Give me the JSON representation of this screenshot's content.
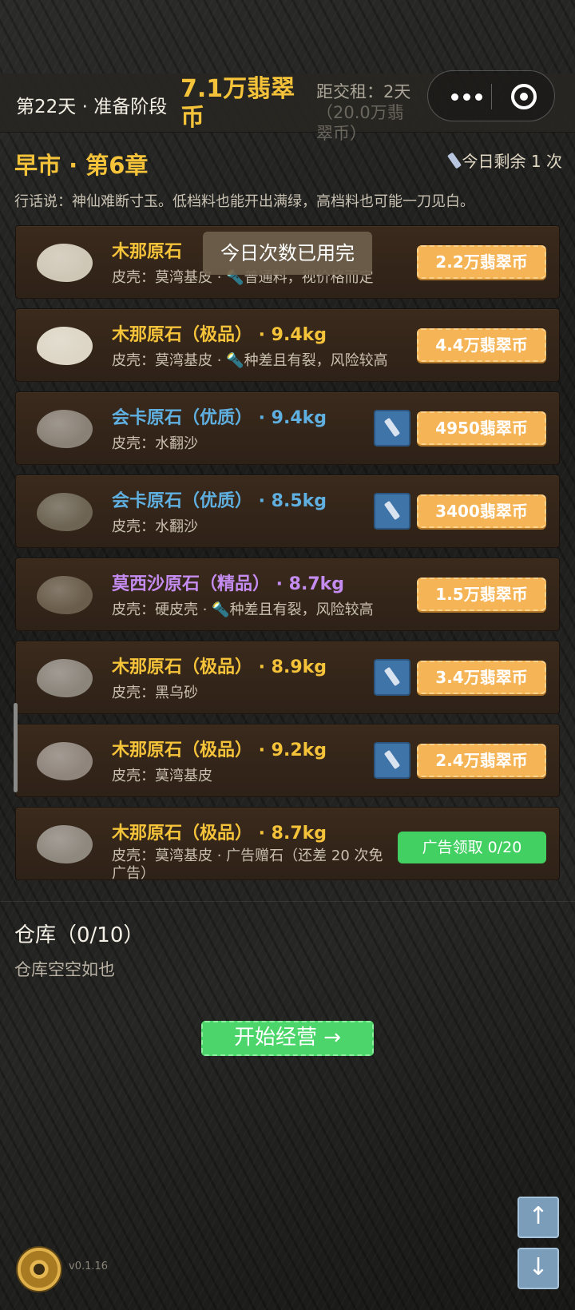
{
  "header": {
    "day_phase": "第22天 · 准备阶段",
    "coins": "7.1万翡翠币",
    "rent_label": "距交租：2天",
    "rent_amount": "（20.0万翡翠币）"
  },
  "market": {
    "title": "早市 · 第6章",
    "remaining": "今日剩余 1 次",
    "saying": "行话说：神仙难断寸玉。低档料也能开出满绿，高档料也可能一刀见白。"
  },
  "toast": "今日次数已用完",
  "stones": [
    {
      "title": "木那原石",
      "sub": "皮壳：莫湾基皮 · 🔦普通料，视价格而定",
      "price": "2.2万翡翠币",
      "title_color": "#f5c33a",
      "stone_color": "#cfc7b6",
      "has_flashlight": false,
      "action": "buy"
    },
    {
      "title": "木那原石（极品） · 9.4kg",
      "sub": "皮壳：莫湾基皮 · 🔦种差且有裂，风险较高",
      "price": "4.4万翡翠币",
      "title_color": "#f5c33a",
      "stone_color": "#ddd6c6",
      "has_flashlight": false,
      "action": "buy"
    },
    {
      "title": "会卡原石（优质） · 9.4kg",
      "sub": "皮壳：水翻沙",
      "price": "4950翡翠币",
      "title_color": "#5fb0e0",
      "stone_color": "#8a8176",
      "has_flashlight": true,
      "action": "buy"
    },
    {
      "title": "会卡原石（优质） · 8.5kg",
      "sub": "皮壳：水翻沙",
      "price": "3400翡翠币",
      "title_color": "#5fb0e0",
      "stone_color": "#6d6453",
      "has_flashlight": true,
      "action": "buy"
    },
    {
      "title": "莫西沙原石（精品） · 8.7kg",
      "sub": "皮壳：硬皮壳 · 🔦种差且有裂，风险较高",
      "price": "1.5万翡翠币",
      "title_color": "#c48cf0",
      "stone_color": "#6a5d4b",
      "has_flashlight": false,
      "action": "buy"
    },
    {
      "title": "木那原石（极品） · 8.9kg",
      "sub": "皮壳：黑乌砂",
      "price": "3.4万翡翠币",
      "title_color": "#f5c33a",
      "stone_color": "#8c857c",
      "has_flashlight": true,
      "action": "buy"
    },
    {
      "title": "木那原石（极品） · 9.2kg",
      "sub": "皮壳：莫湾基皮",
      "price": "2.4万翡翠币",
      "title_color": "#f5c33a",
      "stone_color": "#8f857c",
      "has_flashlight": true,
      "action": "buy"
    },
    {
      "title": "木那原石（极品） · 8.7kg",
      "sub": "皮壳：莫湾基皮 · 广告赠石（还差 20 次免广告）",
      "price": "广告领取 0/20",
      "title_color": "#f5c33a",
      "stone_color": "#8f887f",
      "has_flashlight": false,
      "action": "ad"
    }
  ],
  "warehouse": {
    "title": "仓库（0/10）",
    "empty": "仓库空空如也"
  },
  "start_button": "开始经营 →",
  "version": "v0.1.16",
  "scroll_up": "↑",
  "scroll_down": "↓"
}
